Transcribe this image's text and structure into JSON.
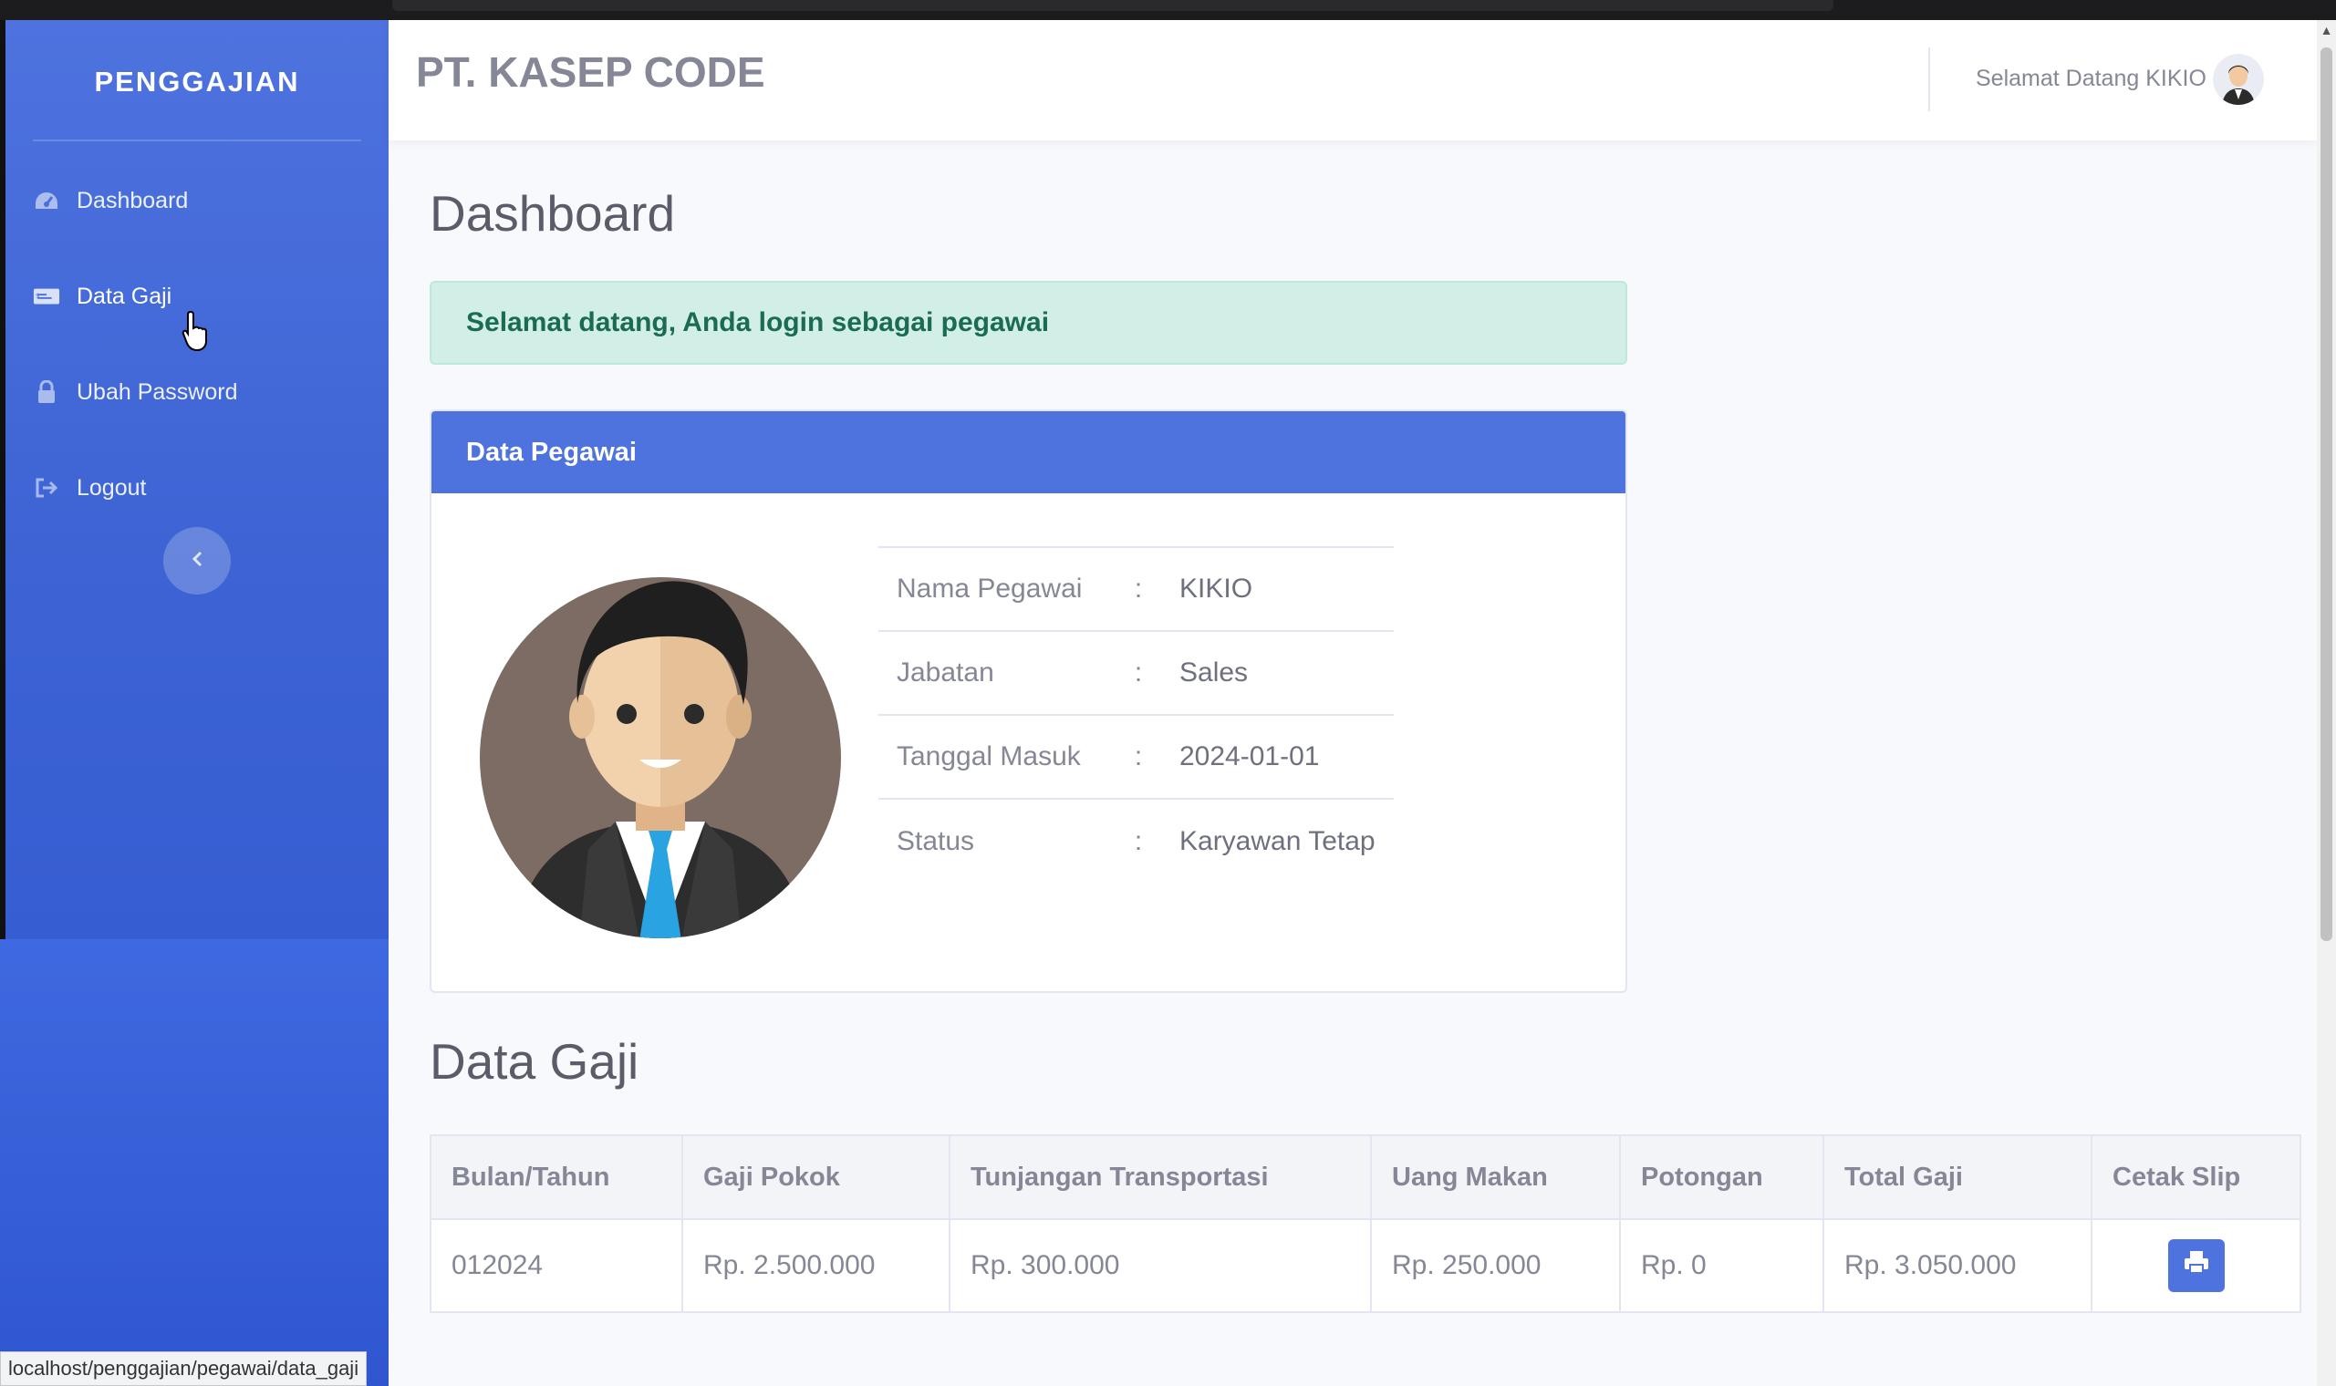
{
  "sidebar": {
    "brand": "PENGGAJIAN",
    "items": [
      {
        "label": "Dashboard",
        "icon": "tachometer-icon"
      },
      {
        "label": "Data Gaji",
        "icon": "money-bill-icon"
      },
      {
        "label": "Ubah Password",
        "icon": "lock-icon"
      },
      {
        "label": "Logout",
        "icon": "sign-out-icon"
      }
    ],
    "toggle_icon": "chevron-left-icon"
  },
  "topbar": {
    "company": "PT. KASEP CODE",
    "welcome": "Selamat Datang KIKIO"
  },
  "page": {
    "title": "Dashboard",
    "alert": "Selamat datang, Anda login sebagai pegawai"
  },
  "employee_card": {
    "header": "Data Pegawai",
    "rows": [
      {
        "label": "Nama Pegawai",
        "sep": ":",
        "value": "KIKIO"
      },
      {
        "label": "Jabatan",
        "sep": ":",
        "value": "Sales"
      },
      {
        "label": "Tanggal Masuk",
        "sep": ":",
        "value": "2024-01-01"
      },
      {
        "label": "Status",
        "sep": ":",
        "value": "Karyawan Tetap"
      }
    ]
  },
  "salary": {
    "title": "Data Gaji",
    "columns": [
      "Bulan/Tahun",
      "Gaji Pokok",
      "Tunjangan Transportasi",
      "Uang Makan",
      "Potongan",
      "Total Gaji",
      "Cetak Slip"
    ],
    "rows": [
      {
        "period": "012024",
        "base": "Rp. 2.500.000",
        "transport": "Rp. 300.000",
        "meal": "Rp. 250.000",
        "deduction": "Rp. 0",
        "total": "Rp. 3.050.000",
        "action_icon": "print-icon"
      }
    ]
  },
  "status_bar": "localhost/penggajian/pegawai/data_gaji",
  "colors": {
    "primary": "#4e73df",
    "sidebar_dark": "#2e57d0",
    "alert_bg": "#d1efe6",
    "alert_text": "#1a6b52",
    "text_muted": "#858796"
  }
}
